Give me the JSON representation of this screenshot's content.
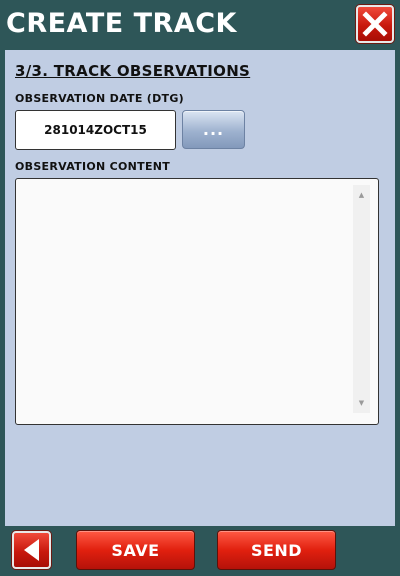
{
  "window": {
    "title": "CREATE TRACK",
    "close_icon": "close-x-icon"
  },
  "form": {
    "section_title": "3/3. TRACK OBSERVATIONS",
    "date_label": "OBSERVATION DATE (DTG)",
    "date_value": "281014ZOCT15",
    "picker_label": "...",
    "content_label": "OBSERVATION CONTENT",
    "content_value": ""
  },
  "footer": {
    "back_icon": "back-arrow-icon",
    "save_label": "SAVE",
    "send_label": "SEND"
  },
  "colors": {
    "frame": "#2e5658",
    "panel": "#c0cde3",
    "button_red": "#e1200f"
  }
}
